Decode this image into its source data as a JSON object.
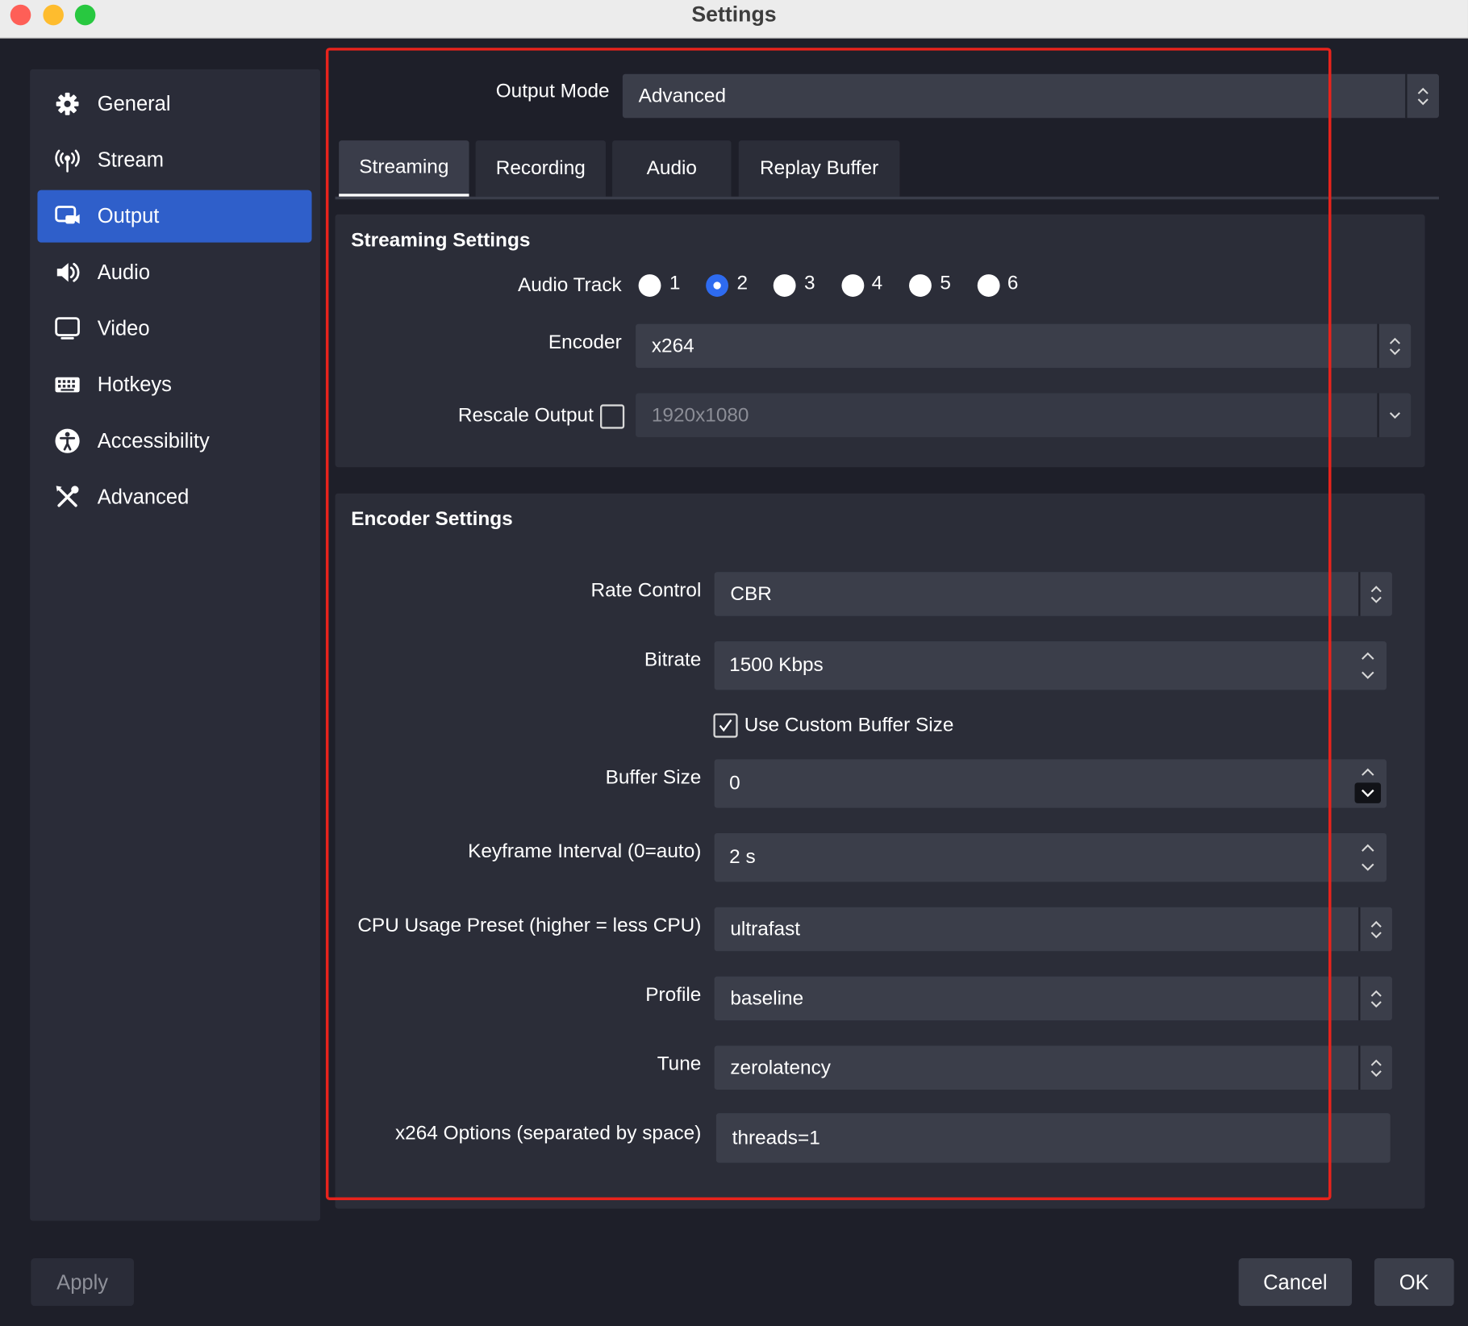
{
  "window": {
    "title": "Settings"
  },
  "sidebar": {
    "items": [
      {
        "label": "General",
        "icon": "gear-icon"
      },
      {
        "label": "Stream",
        "icon": "antenna-icon"
      },
      {
        "label": "Output",
        "icon": "output-icon",
        "active": true
      },
      {
        "label": "Audio",
        "icon": "speaker-icon"
      },
      {
        "label": "Video",
        "icon": "monitor-icon"
      },
      {
        "label": "Hotkeys",
        "icon": "keyboard-icon"
      },
      {
        "label": "Accessibility",
        "icon": "accessibility-icon"
      },
      {
        "label": "Advanced",
        "icon": "tools-icon"
      }
    ]
  },
  "output_mode": {
    "label": "Output Mode",
    "value": "Advanced"
  },
  "tabs": [
    {
      "label": "Streaming",
      "active": true
    },
    {
      "label": "Recording"
    },
    {
      "label": "Audio"
    },
    {
      "label": "Replay Buffer"
    }
  ],
  "streaming": {
    "heading": "Streaming Settings",
    "audio_track": {
      "label": "Audio Track",
      "options": [
        "1",
        "2",
        "3",
        "4",
        "5",
        "6"
      ],
      "selected": "2"
    },
    "encoder": {
      "label": "Encoder",
      "value": "x264"
    },
    "rescale": {
      "label": "Rescale Output",
      "checked": false,
      "value": "1920x1080"
    }
  },
  "encoder_settings": {
    "heading": "Encoder Settings",
    "rate_control": {
      "label": "Rate Control",
      "value": "CBR"
    },
    "bitrate": {
      "label": "Bitrate",
      "value": "1500 Kbps"
    },
    "custom_buffer": {
      "label": "Use Custom Buffer Size",
      "checked": true
    },
    "buffer_size": {
      "label": "Buffer Size",
      "value": "0"
    },
    "keyframe": {
      "label": "Keyframe Interval (0=auto)",
      "value": "2 s"
    },
    "cpu_preset": {
      "label": "CPU Usage Preset (higher = less CPU)",
      "value": "ultrafast"
    },
    "profile": {
      "label": "Profile",
      "value": "baseline"
    },
    "tune": {
      "label": "Tune",
      "value": "zerolatency"
    },
    "x264_options": {
      "label": "x264 Options (separated by space)",
      "value": "threads=1"
    }
  },
  "footer": {
    "apply": "Apply",
    "cancel": "Cancel",
    "ok": "OK"
  },
  "colors": {
    "accent": "#2f5fca",
    "highlight": "#e8231c",
    "background": "#1e1f29",
    "panel": "#2b2d38",
    "field": "#3b3e4a"
  }
}
